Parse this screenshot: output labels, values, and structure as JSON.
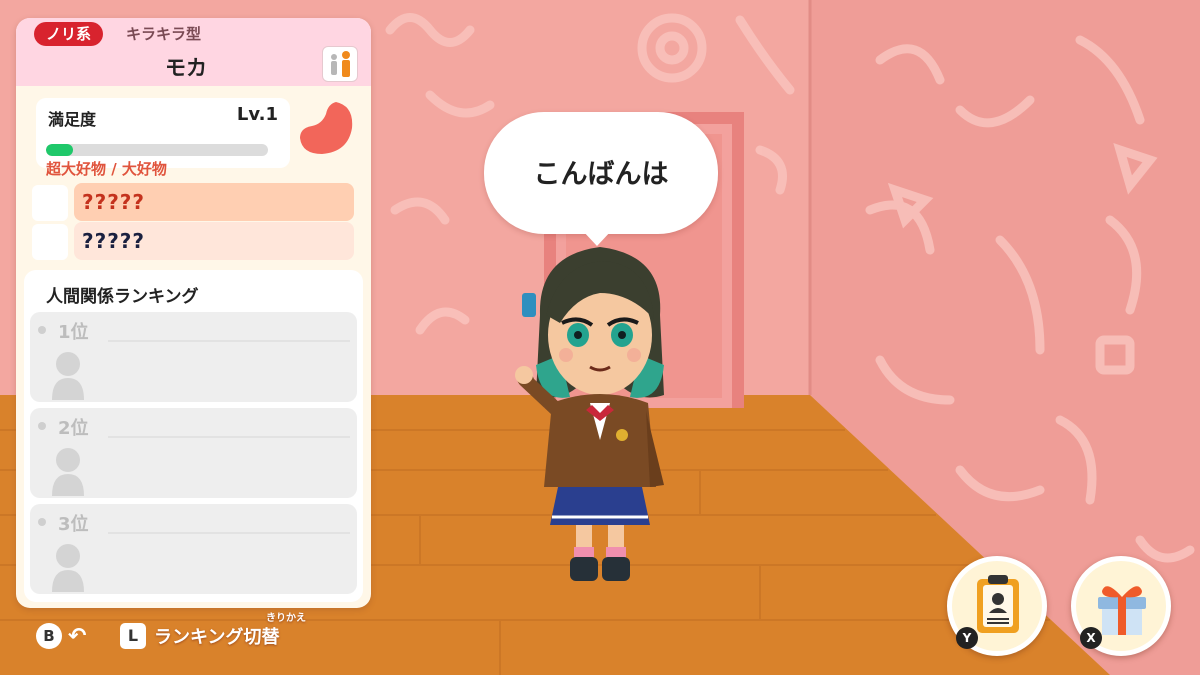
{
  "status_panel": {
    "type_label": "ノリ系",
    "subtype_label": "キラキラ型",
    "name": "モカ",
    "satisfaction": {
      "label": "満足度",
      "level": "Lv.1",
      "fill_fraction": 0.12
    },
    "likes": {
      "heading": "超大好物 / 大好物",
      "items": [
        "?????",
        "?????"
      ]
    },
    "ranking": {
      "title": "人間関係ランキング",
      "items": [
        "1位",
        "2位",
        "3位"
      ]
    }
  },
  "hints": {
    "back_button": "B",
    "switch_button": "L",
    "switch_label": "ランキング切替",
    "switch_ruby": "きりかえ"
  },
  "speech": {
    "text": "こんばんは"
  },
  "actions": {
    "profile_key": "Y",
    "gift_key": "X"
  },
  "colors": {
    "accent_red": "#d8232e",
    "satisfaction_green": "#1fc86a",
    "wall_pink": "#f2a39d",
    "floor_orange": "#d9822b"
  }
}
